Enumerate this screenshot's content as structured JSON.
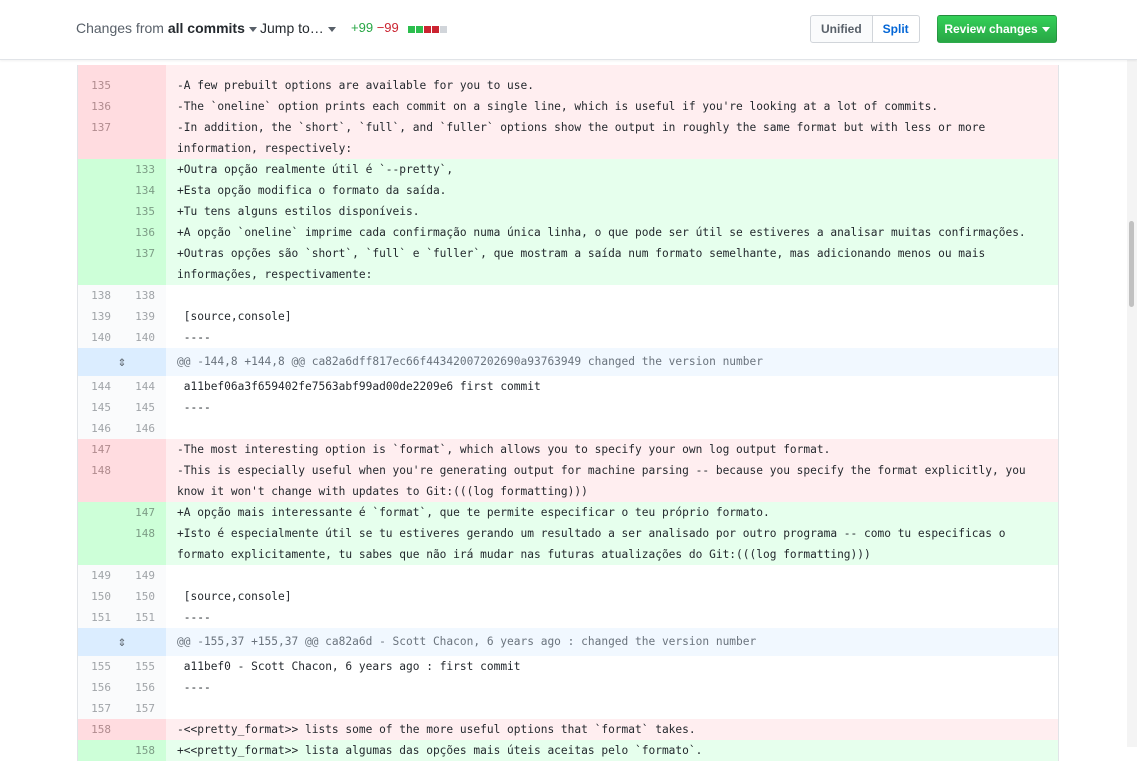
{
  "toolbar": {
    "changes_prefix": "Changes from",
    "changes_value": "all commits",
    "jump_label": "Jump to…",
    "additions": "+99",
    "deletions": "−99",
    "diffstat": [
      "add",
      "add",
      "del",
      "del",
      "neutral"
    ],
    "unified_label": "Unified",
    "split_label": "Split",
    "review_label": "Review changes",
    "colors": {
      "add": "#2cbe4e",
      "del": "#cb2431",
      "neutral": "#d1d5da"
    }
  },
  "diff_lines": [
    {
      "type": "del",
      "old": "",
      "new": "",
      "text": " "
    },
    {
      "type": "del",
      "old": "135",
      "new": "",
      "text": "-A few prebuilt options are available for you to use."
    },
    {
      "type": "del",
      "old": "136",
      "new": "",
      "text": "-The `oneline` option prints each commit on a single line, which is useful if you're looking at a lot of commits."
    },
    {
      "type": "del",
      "old": "137",
      "new": "",
      "text": "-In addition, the `short`, `full`, and `fuller` options show the output in roughly the same format but with less or more information, respectively:"
    },
    {
      "type": "add",
      "old": "",
      "new": "133",
      "text": "+Outra opção realmente útil é `--pretty`,"
    },
    {
      "type": "add",
      "old": "",
      "new": "134",
      "text": "+Esta opção modifica o formato da saída."
    },
    {
      "type": "add",
      "old": "",
      "new": "135",
      "text": "+Tu tens alguns estilos disponíveis."
    },
    {
      "type": "add",
      "old": "",
      "new": "136",
      "text": "+A opção `oneline` imprime cada confirmação numa única linha, o que pode ser útil se estiveres a analisar muitas confirmações."
    },
    {
      "type": "add",
      "old": "",
      "new": "137",
      "text": "+Outras opções são `short`, `full` e `fuller`, que mostram a saída num formato semelhante, mas adicionando menos ou mais informações, respectivamente:"
    },
    {
      "type": "ctx",
      "old": "138",
      "new": "138",
      "text": " "
    },
    {
      "type": "ctx",
      "old": "139",
      "new": "139",
      "text": " [source,console]"
    },
    {
      "type": "ctx",
      "old": "140",
      "new": "140",
      "text": " ----"
    },
    {
      "type": "hunk",
      "text": "@@ -144,8 +144,8 @@ ca82a6dff817ec66f44342007202690a93763949 changed the version number"
    },
    {
      "type": "ctx",
      "old": "144",
      "new": "144",
      "text": " a11bef06a3f659402fe7563abf99ad00de2209e6 first commit"
    },
    {
      "type": "ctx",
      "old": "145",
      "new": "145",
      "text": " ----"
    },
    {
      "type": "ctx",
      "old": "146",
      "new": "146",
      "text": " "
    },
    {
      "type": "del",
      "old": "147",
      "new": "",
      "text": "-The most interesting option is `format`, which allows you to specify your own log output format."
    },
    {
      "type": "del",
      "old": "148",
      "new": "",
      "text": "-This is especially useful when you're generating output for machine parsing -- because you specify the format explicitly, you know it won't change with updates to Git:(((log formatting)))"
    },
    {
      "type": "add",
      "old": "",
      "new": "147",
      "text": "+A opção mais interessante é `format`, que te permite especificar o teu próprio formato."
    },
    {
      "type": "add",
      "old": "",
      "new": "148",
      "text": "+Isto é especialmente útil se tu estiveres gerando um resultado a ser analisado por outro programa -- como tu especificas o formato explicitamente, tu sabes que não irá mudar nas futuras atualizações do Git:(((log formatting)))"
    },
    {
      "type": "ctx",
      "old": "149",
      "new": "149",
      "text": " "
    },
    {
      "type": "ctx",
      "old": "150",
      "new": "150",
      "text": " [source,console]"
    },
    {
      "type": "ctx",
      "old": "151",
      "new": "151",
      "text": " ----"
    },
    {
      "type": "hunk",
      "text": "@@ -155,37 +155,37 @@ ca82a6d - Scott Chacon, 6 years ago : changed the version number"
    },
    {
      "type": "ctx",
      "old": "155",
      "new": "155",
      "text": " a11bef0 - Scott Chacon, 6 years ago : first commit"
    },
    {
      "type": "ctx",
      "old": "156",
      "new": "156",
      "text": " ----"
    },
    {
      "type": "ctx",
      "old": "157",
      "new": "157",
      "text": " "
    },
    {
      "type": "del",
      "old": "158",
      "new": "",
      "text": "-<<pretty_format>> lists some of the more useful options that `format` takes."
    },
    {
      "type": "add",
      "old": "",
      "new": "158",
      "text": "+<<pretty_format>> lista algumas das opções mais úteis aceitas pelo `formato`."
    }
  ]
}
